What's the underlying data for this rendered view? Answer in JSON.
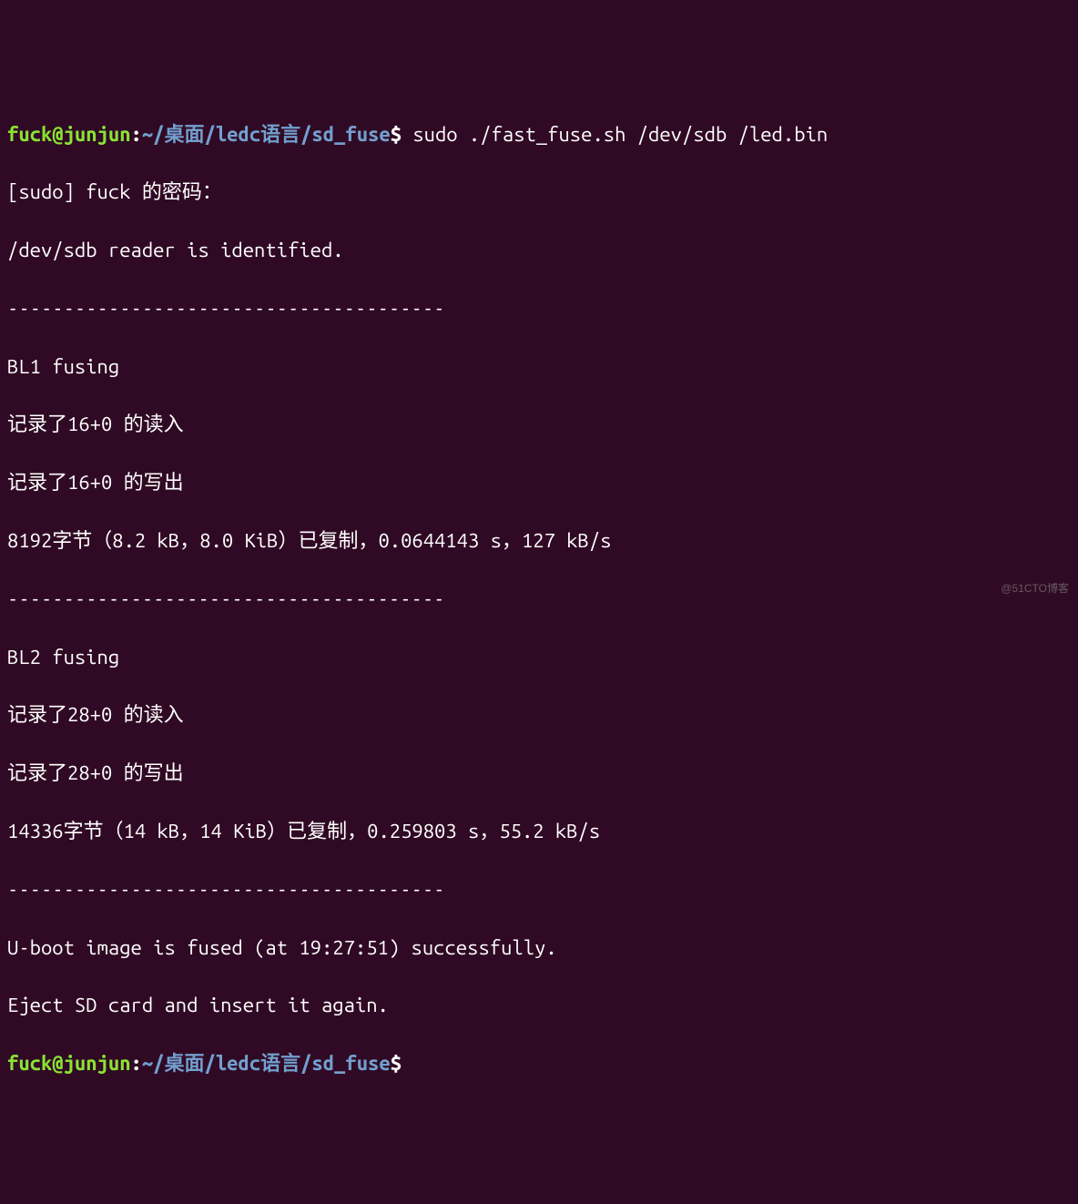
{
  "prompt1": {
    "user": "fuck@junjun",
    "colon": ":",
    "path": "~/桌面/ledc语言/sd_fuse",
    "dollar": "$",
    "command": " sudo ./fast_fuse.sh /dev/sdb /led.bin"
  },
  "lines": [
    "[sudo] fuck 的密码：",
    "/dev/sdb reader is identified.",
    "---------------------------------------",
    "BL1 fusing",
    "记录了16+0 的读入",
    "记录了16+0 的写出",
    "8192字节（8.2 kB，8.0 KiB）已复制，0.0644143 s，127 kB/s",
    "---------------------------------------",
    "BL2 fusing",
    "记录了28+0 的读入",
    "记录了28+0 的写出",
    "14336字节（14 kB，14 KiB）已复制，0.259803 s，55.2 kB/s",
    "---------------------------------------",
    "U-boot image is fused (at 19:27:51) successfully.",
    "Eject SD card and insert it again."
  ],
  "prompt2": {
    "user": "fuck@junjun",
    "colon": ":",
    "path": "~/桌面/ledc语言/sd_fuse",
    "dollar": "$"
  },
  "watermark": "@51CTO博客"
}
